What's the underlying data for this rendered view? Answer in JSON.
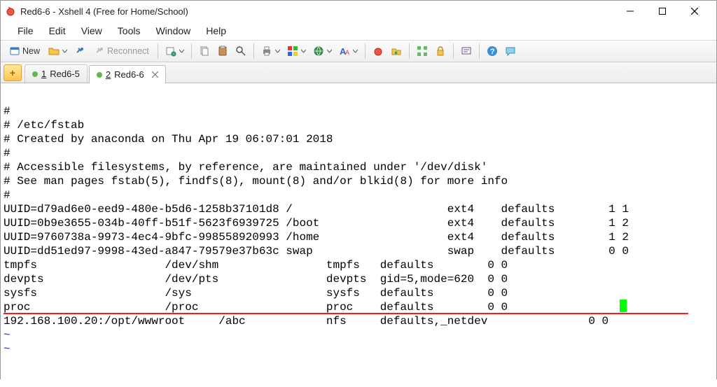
{
  "window": {
    "title": "Red6-6 - Xshell 4 (Free for Home/School)"
  },
  "menubar": [
    "File",
    "Edit",
    "View",
    "Tools",
    "Window",
    "Help"
  ],
  "toolbar": {
    "new_label": "New",
    "reconnect_label": "Reconnect"
  },
  "tabs": [
    {
      "index": "1",
      "label": "Red6-5",
      "active": false
    },
    {
      "index": "2",
      "label": "Red6-6",
      "active": true
    }
  ],
  "terminal_lines": [
    "#",
    "# /etc/fstab",
    "# Created by anaconda on Thu Apr 19 06:07:01 2018",
    "#",
    "# Accessible filesystems, by reference, are maintained under '/dev/disk'",
    "# See man pages fstab(5), findfs(8), mount(8) and/or blkid(8) for more info",
    "#",
    "UUID=d79ad6e0-eed9-480e-b5d6-1258b37101d8 /                       ext4    defaults        1 1",
    "UUID=0b9e3655-034b-40ff-b51f-5623f6939725 /boot                   ext4    defaults        1 2",
    "UUID=9760738a-9973-4ec4-9bfc-998558920993 /home                   ext4    defaults        1 2",
    "UUID=dd51ed97-9998-43ed-a847-79579e37b63c swap                    swap    defaults        0 0",
    "tmpfs                   /dev/shm                tmpfs   defaults        0 0",
    "devpts                  /dev/pts                devpts  gid=5,mode=620  0 0",
    "sysfs                   /sys                    sysfs   defaults        0 0",
    "proc                    /proc                   proc    defaults        0 0",
    "192.168.100.20:/opt/wwwroot     /abc            nfs     defaults,_netdev               0 0"
  ]
}
